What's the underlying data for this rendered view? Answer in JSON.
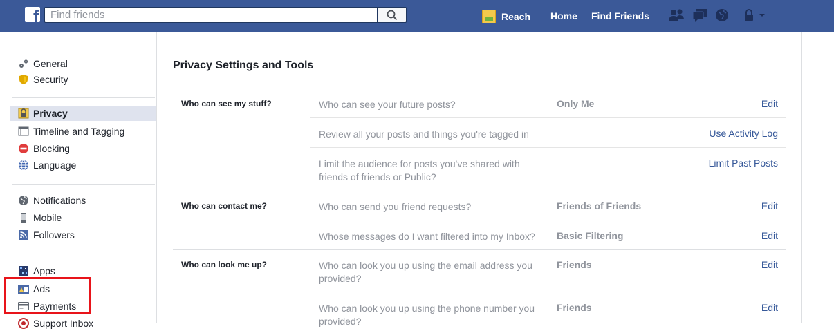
{
  "topbar": {
    "logo_letter": "f",
    "search_placeholder": "Find friends",
    "profile_name": "Reach",
    "home_label": "Home",
    "find_friends_label": "Find Friends"
  },
  "sidebar": {
    "items": [
      {
        "label": "General",
        "icon": "gear-icon"
      },
      {
        "label": "Security",
        "icon": "shield-icon"
      },
      {
        "label": "Privacy",
        "icon": "lock-icon"
      },
      {
        "label": "Timeline and Tagging",
        "icon": "timeline-icon"
      },
      {
        "label": "Blocking",
        "icon": "block-icon"
      },
      {
        "label": "Language",
        "icon": "globe-icon"
      },
      {
        "label": "Notifications",
        "icon": "notifications-globe-icon"
      },
      {
        "label": "Mobile",
        "icon": "mobile-icon"
      },
      {
        "label": "Followers",
        "icon": "rss-icon"
      },
      {
        "label": "Apps",
        "icon": "apps-icon"
      },
      {
        "label": "Ads",
        "icon": "ads-icon"
      },
      {
        "label": "Payments",
        "icon": "credit-card-icon"
      },
      {
        "label": "Support Inbox",
        "icon": "support-icon"
      }
    ],
    "active": "Privacy"
  },
  "main": {
    "title": "Privacy Settings and Tools",
    "sections": [
      {
        "label": "Who can see my stuff?",
        "rows": [
          {
            "question": "Who can see your future posts?",
            "value": "Only Me",
            "action": "Edit"
          },
          {
            "question": "Review all your posts and things you're tagged in",
            "value": "",
            "action": "Use Activity Log"
          },
          {
            "question": "Limit the audience for posts you've shared with friends of friends or Public?",
            "value": "",
            "action": "Limit Past Posts"
          }
        ]
      },
      {
        "label": "Who can contact me?",
        "rows": [
          {
            "question": "Who can send you friend requests?",
            "value": "Friends of Friends",
            "action": "Edit"
          },
          {
            "question": "Whose messages do I want filtered into my Inbox?",
            "value": "Basic Filtering",
            "action": "Edit"
          }
        ]
      },
      {
        "label": "Who can look me up?",
        "rows": [
          {
            "question": "Who can look you up using the email address you provided?",
            "value": "Friends",
            "action": "Edit"
          },
          {
            "question": "Who can look you up using the phone number you provided?",
            "value": "Friends",
            "action": "Edit"
          }
        ]
      }
    ]
  },
  "colors": {
    "brand": "#3b5998",
    "link": "#365899",
    "active_bg": "#dfe3ee",
    "annotation": "#e8141a"
  }
}
